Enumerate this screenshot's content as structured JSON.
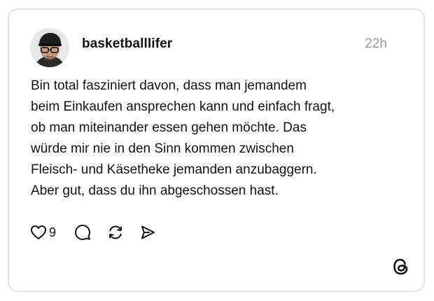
{
  "post": {
    "username": "basketballlifer",
    "timestamp": "22h",
    "text_lines": [
      "Bin total fasziniert davon, dass man jemandem",
      "beim Einkaufen ansprechen kann und einfach fragt,",
      "ob man miteinander essen gehen möchte. Das",
      "würde mir nie in den Sinn kommen zwischen",
      "Fleisch- und Käsetheke jemanden anzubaggern.",
      "Aber gut, dass du ihn abgeschossen hast."
    ],
    "like_count": "9"
  },
  "icons": {
    "avatar": "avatar-photo",
    "like": "heart-icon",
    "reply": "comment-icon",
    "repost": "repost-icon",
    "share": "send-icon",
    "brand": "threads-logo-icon"
  },
  "colors": {
    "text": "#111111",
    "muted": "#9a9a9a",
    "border": "#e4e4e4"
  }
}
